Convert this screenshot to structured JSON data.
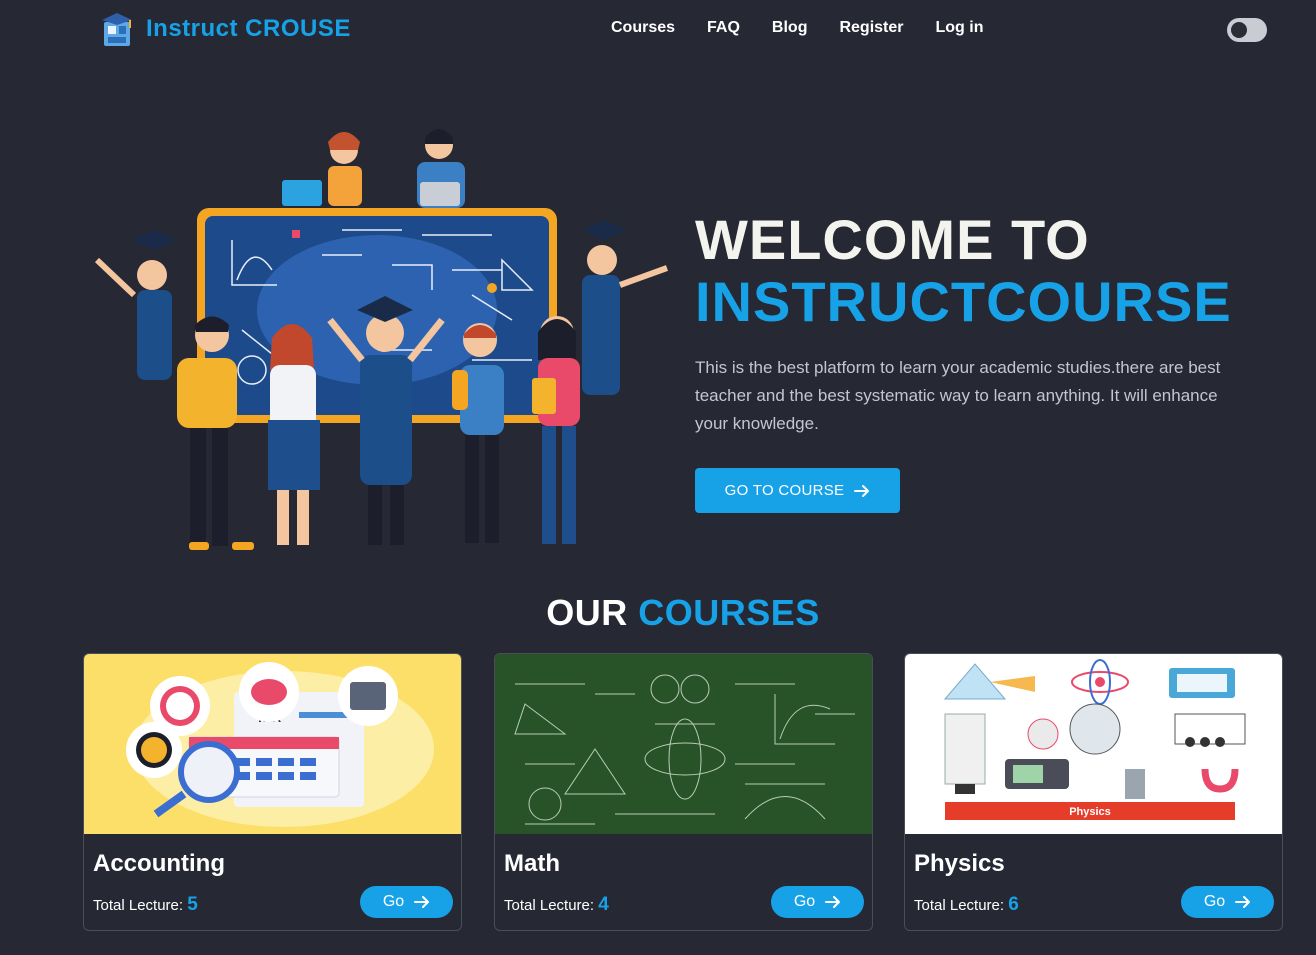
{
  "brand": {
    "name": "Instruct CROUSE",
    "icon": "school-building-icon"
  },
  "nav": {
    "links": [
      "Courses",
      "FAQ",
      "Blog",
      "Register",
      "Log in"
    ],
    "theme_toggle": "dark-mode-toggle"
  },
  "hero": {
    "title_line1": "WELCOME TO",
    "title_line2": "INSTRUCTCOURSE",
    "description": "This is the best platform to learn your academic studies.there are best teacher and the best systematic way to learn anything. It will enhance your knowledge.",
    "button_label": "GO TO COURSE",
    "button_icon": "arrow-right-icon",
    "illustration": "students-with-chalkboard-illustration"
  },
  "courses_section": {
    "title_white": "OUR",
    "title_blue": "COURSES"
  },
  "courses": [
    {
      "title": "Accounting",
      "lecture_label": "Total Lecture:",
      "lecture_count": "5",
      "button_label": "Go",
      "image": "accounting-tax-illustration"
    },
    {
      "title": "Math",
      "lecture_label": "Total Lecture:",
      "lecture_count": "4",
      "button_label": "Go",
      "image": "math-chalkboard-image"
    },
    {
      "title": "Physics",
      "lecture_label": "Total Lecture:",
      "lecture_count": "6",
      "button_label": "Go",
      "image": "physics-instruments-illustration"
    }
  ],
  "colors": {
    "background": "#262834",
    "accent": "#17a2e8",
    "heading": "#f4f4ee"
  }
}
